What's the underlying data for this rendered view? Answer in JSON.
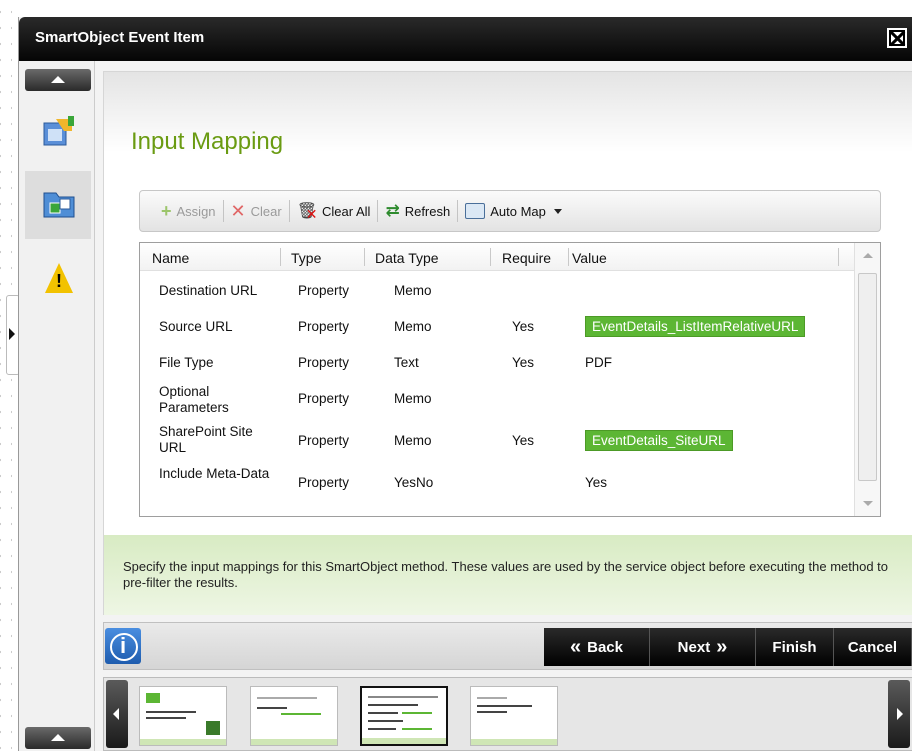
{
  "window": {
    "title": "SmartObject Event Item",
    "close_icon": "close-box-icon"
  },
  "page": {
    "heading": "Input Mapping"
  },
  "toolbar": {
    "assign": "Assign",
    "clear": "Clear",
    "clear_all": "Clear All",
    "refresh": "Refresh",
    "auto_map": "Auto Map"
  },
  "grid": {
    "columns": [
      "Name",
      "Type",
      "Data Type",
      "Require",
      "Value"
    ],
    "rows": [
      {
        "name": "Destination URL",
        "type": "Property",
        "data_type": "Memo",
        "required": "",
        "value": ""
      },
      {
        "name": "Source URL",
        "type": "Property",
        "data_type": "Memo",
        "required": "Yes",
        "value": "EventDetails_ListItemRelativeURL",
        "value_is_field": true
      },
      {
        "name": "File Type",
        "type": "Property",
        "data_type": "Text",
        "required": "Yes",
        "value": "PDF"
      },
      {
        "name": "Optional Parameters",
        "type": "Property",
        "data_type": "Memo",
        "required": "",
        "value": ""
      },
      {
        "name": "SharePoint Site URL",
        "type": "Property",
        "data_type": "Memo",
        "required": "Yes",
        "value": "EventDetails_SiteURL",
        "value_is_field": true
      },
      {
        "name": "Include Meta-Data",
        "type": "Property",
        "data_type": "YesNo",
        "required": "",
        "value": "Yes"
      }
    ]
  },
  "hint": "Specify the input mappings for this SmartObject method. These values are used by the service object before executing the method to pre-filter the results.",
  "wizard": {
    "back": "Back",
    "next": "Next",
    "finish": "Finish",
    "cancel": "Cancel"
  },
  "thumbnails": {
    "count": 4,
    "selected_index": 2
  },
  "colors": {
    "heading": "#6a9b12",
    "field_chip": "#5cb634",
    "hint_bg": "#d8ebc3"
  }
}
